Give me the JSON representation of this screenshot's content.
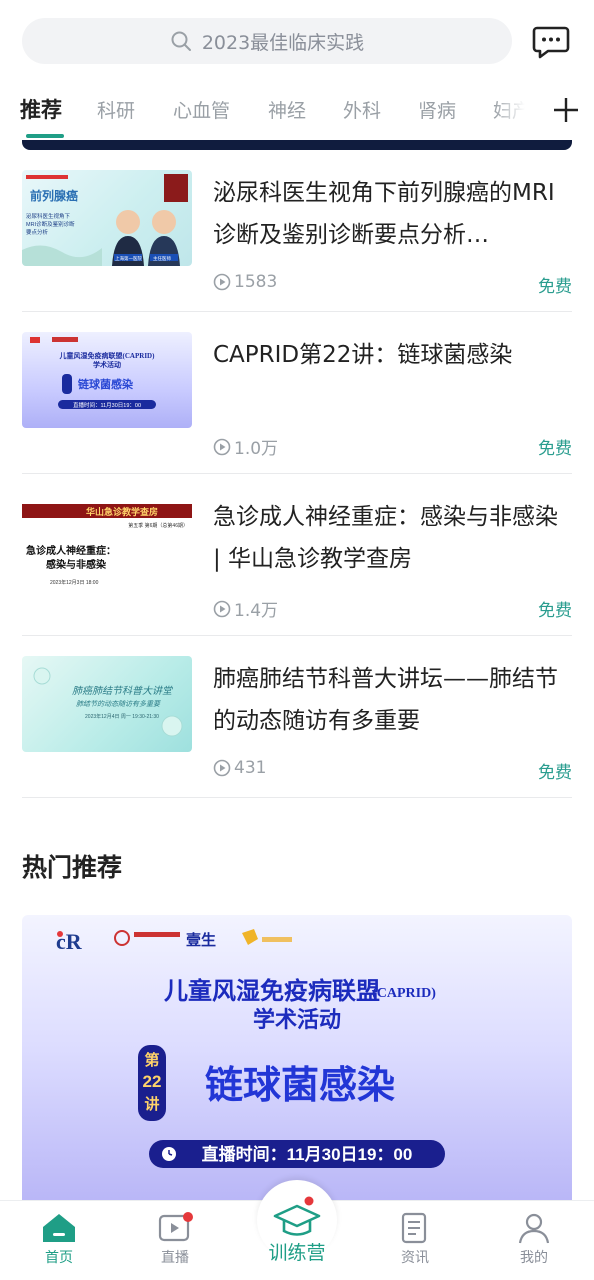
{
  "search": {
    "placeholder": "2023最佳临床实践"
  },
  "tabs": [
    {
      "label": "推荐",
      "active": true
    },
    {
      "label": "科研"
    },
    {
      "label": "心血管"
    },
    {
      "label": "神经"
    },
    {
      "label": "外科"
    },
    {
      "label": "肾病"
    },
    {
      "label": "妇产"
    }
  ],
  "items": [
    {
      "title": "泌尿科医生视角下前列腺癌的MRI诊断及鉴别诊断要点分析…",
      "views": "1583",
      "price": "免费",
      "thumb": {
        "heading": "前列腺癌",
        "sub1": "泌尿科医生视角下",
        "sub2": "MRI诊断及鉴别诊断",
        "sub3": "要点分析",
        "speaker1": "上海第一医院",
        "speaker2": "主任医师"
      }
    },
    {
      "title": "CAPRID第22讲：链球菌感染",
      "views": "1.0万",
      "price": "免费",
      "thumb": {
        "org": "儿童风湿免疫病联盟(CAPRID)",
        "sub": "学术活动",
        "lecture": "第22讲",
        "topic": "链球菌感染",
        "time": "直播时间：11月30日19：00"
      }
    },
    {
      "title": "急诊成人神经重症：感染与非感染 | 华山急诊教学查房",
      "views": "1.4万",
      "price": "免费",
      "thumb": {
        "brand": "华山急诊教学查房",
        "season": "第五季 第6期（总第46期）",
        "line1": "急诊成人神经重症：",
        "line2": "感染与非感染",
        "date": "2023年12月3日 18:00"
      }
    },
    {
      "title": "肺癌肺结节科普大讲坛——肺结节的动态随访有多重要",
      "views": "431",
      "price": "免费",
      "thumb": {
        "heading": "肺癌肺结节科普大讲堂",
        "sub": "肺结节的动态随访有多重要",
        "time": "2023年12月4日 周一 19:30-21:30"
      }
    }
  ],
  "hot": {
    "section_title": "热门推荐",
    "logo_text": "壹生",
    "org": "儿童风湿免疫病联盟",
    "org_suffix": "(CAPRID)",
    "sub": "学术活动",
    "lecture_top": "第",
    "lecture_num": "22",
    "lecture_bottom": "讲",
    "topic": "链球菌感染",
    "time": "直播时间：11月30日19：00"
  },
  "nav": {
    "home": "首页",
    "live": "直播",
    "camp": "训练营",
    "news": "资讯",
    "me": "我的"
  },
  "colors": {
    "accent": "#1f9e86",
    "free": "#2a9d8f",
    "badge": "#e5383b"
  }
}
